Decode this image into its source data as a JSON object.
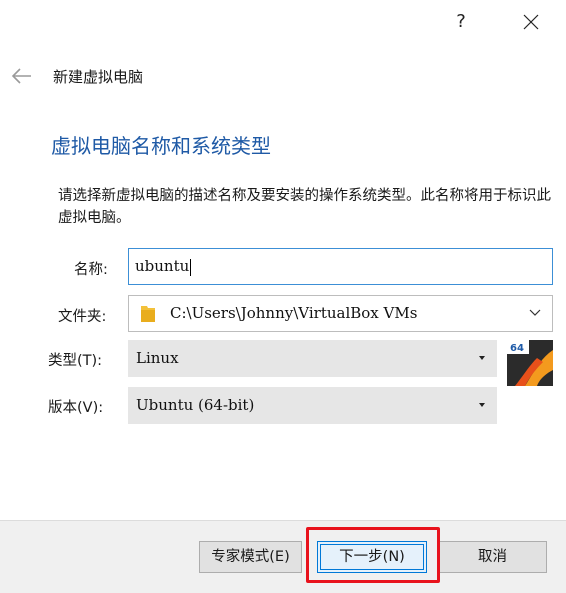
{
  "titlebar": {
    "help": "?",
    "close_icon": "close-icon"
  },
  "wizard": {
    "back_icon": "arrow-left-icon",
    "title": "新建虚拟电脑"
  },
  "page": {
    "title": "虚拟电脑名称和系统类型",
    "description": "请选择新虚拟电脑的描述名称及要安装的操作系统类型。此名称将用于标识此虚拟电脑。"
  },
  "form": {
    "name_label": "名称:",
    "name_value": "ubuntu",
    "folder_label": "文件夹:",
    "folder_value": "C:\\Users\\Johnny\\VirtualBox VMs",
    "type_label": "类型(T):",
    "type_value": "Linux",
    "version_label": "版本(V):",
    "version_value": "Ubuntu (64-bit)",
    "os_icon": "ubuntu-64-icon",
    "os_badge": "64"
  },
  "buttons": {
    "expert": "专家模式(E)",
    "next": "下一步(N)",
    "cancel": "取消"
  },
  "colors": {
    "title_blue": "#1f5aa6",
    "highlight_red": "#e8121c",
    "focus_blue": "#0078d7"
  }
}
